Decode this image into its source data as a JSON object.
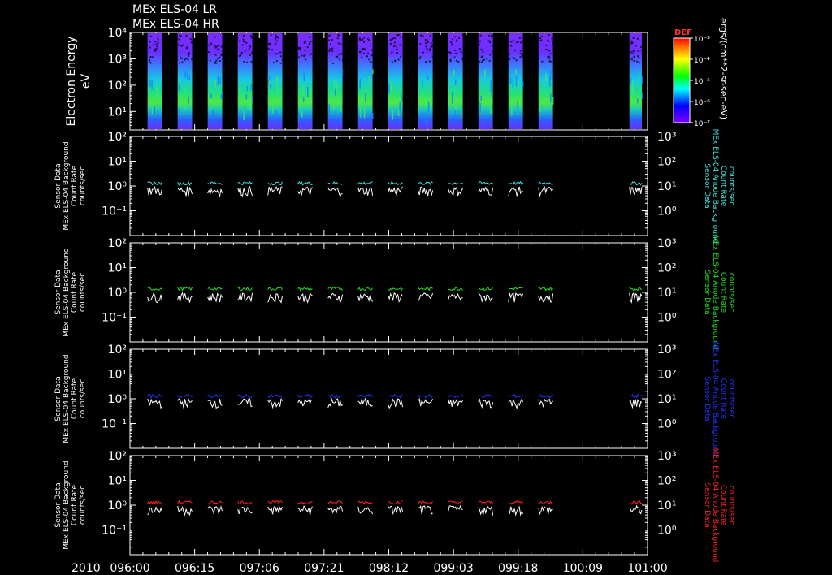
{
  "header": {
    "line1": "MEx ELS-04 LR",
    "line2": "MEx ELS-04 HR"
  },
  "colorbar": {
    "label": "DEF",
    "ticks": [
      "10⁻³",
      "10⁻⁴",
      "10⁻⁵",
      "10⁻⁶",
      "10⁻⁷"
    ],
    "unit": "ergs/(cm**2-sr-sec-eV)"
  },
  "xaxis": {
    "year": "2010",
    "ticks": [
      "096:00",
      "096:15",
      "097:06",
      "097:21",
      "098:12",
      "099:03",
      "099:18",
      "100:09",
      "101:00"
    ]
  },
  "chart_data": [
    {
      "type": "heatmap",
      "ylabel": "Electron Energy",
      "yunit": "eV",
      "yscale": "log",
      "yticks": [
        "10⁴",
        "10³",
        "10²",
        "10¹"
      ],
      "ylim": [
        2,
        10000
      ],
      "colorscale": "rainbow",
      "zlim": [
        1e-07,
        0.001
      ],
      "data_intervals": 15,
      "gap_after_interval": 14
    },
    {
      "type": "line",
      "ylabel_lines": [
        "Sensor Data",
        "MEx ELS-04 Background",
        "Count Rate",
        "counts/sec"
      ],
      "yscale": "log",
      "yticks_left": [
        "10²",
        "10¹",
        "10⁰",
        "10⁻¹"
      ],
      "yticks_right": [
        "10³",
        "10²",
        "10¹",
        "10⁰"
      ],
      "ylim": [
        0.01,
        100
      ],
      "series": [
        {
          "color": "#40e0e0",
          "level": 1.3
        },
        {
          "color": "#ffffff",
          "level": 0.7
        }
      ],
      "right_label_lines": [
        "Sensor Data",
        "MEx ELS-04 Anode Background",
        "Count Rate",
        "counts/sec"
      ],
      "right_color": "#40e0e0"
    },
    {
      "type": "line",
      "ylabel_lines": [
        "Sensor Data",
        "MEx ELS-04 Background",
        "Count Rate",
        "counts/sec"
      ],
      "yscale": "log",
      "yticks_left": [
        "10²",
        "10¹",
        "10⁰",
        "10⁻¹"
      ],
      "yticks_right": [
        "10³",
        "10²",
        "10¹",
        "10⁰"
      ],
      "ylim": [
        0.01,
        100
      ],
      "series": [
        {
          "color": "#22dd22",
          "level": 1.4
        },
        {
          "color": "#ffffff",
          "level": 0.7
        }
      ],
      "right_label_lines": [
        "Sensor Data",
        "MEx ELS-04 Anode Background",
        "Count Rate",
        "counts/sec"
      ],
      "right_color": "#22dd22"
    },
    {
      "type": "line",
      "ylabel_lines": [
        "Sensor Data",
        "MEx ELS-04 Background",
        "Count Rate",
        "counts/sec"
      ],
      "yscale": "log",
      "yticks_left": [
        "10²",
        "10¹",
        "10⁰",
        "10⁻¹"
      ],
      "yticks_right": [
        "10³",
        "10²",
        "10¹",
        "10⁰"
      ],
      "ylim": [
        0.01,
        100
      ],
      "series": [
        {
          "color": "#2233ff",
          "level": 1.3
        },
        {
          "color": "#ffffff",
          "level": 0.75
        }
      ],
      "right_label_lines": [
        "Sensor Data",
        "MEx ELS-04 Anode Background",
        "Count Rate",
        "counts/sec"
      ],
      "right_color": "#2233ff"
    },
    {
      "type": "line",
      "ylabel_lines": [
        "Sensor Data",
        "MEx ELS-04 Background",
        "Count Rate",
        "counts/sec"
      ],
      "yscale": "log",
      "yticks_left": [
        "10²",
        "10¹",
        "10⁰",
        "10⁻¹"
      ],
      "yticks_right": [
        "10³",
        "10²",
        "10¹",
        "10⁰"
      ],
      "ylim": [
        0.01,
        100
      ],
      "series": [
        {
          "color": "#ff2222",
          "level": 1.3
        },
        {
          "color": "#ffffff",
          "level": 0.7
        }
      ],
      "right_label_lines": [
        "Sensor Data",
        "MEx ELS-04 Anode Background",
        "Count Rate",
        "counts/sec"
      ],
      "right_color": "#ff2222"
    }
  ]
}
